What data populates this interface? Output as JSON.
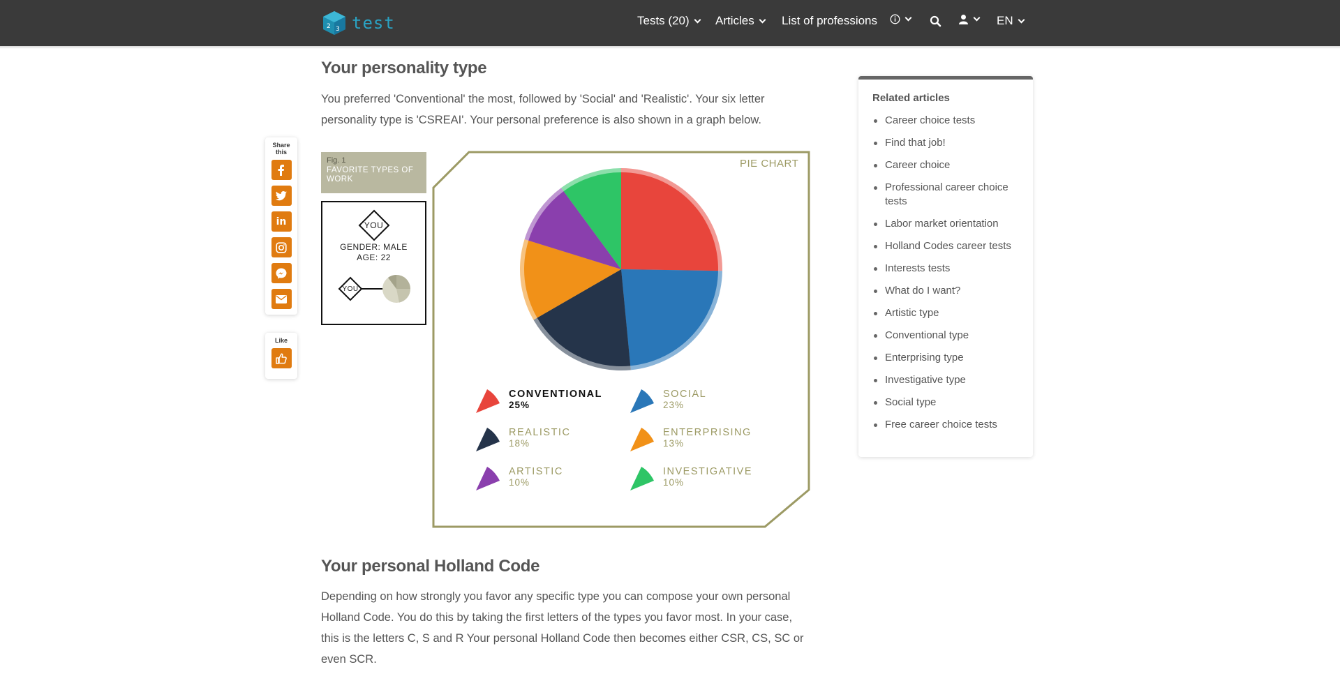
{
  "nav": {
    "logo_text": "test",
    "tests_label": "Tests (20)",
    "articles_label": "Articles",
    "professions_label": "List of professions",
    "lang_label": "EN"
  },
  "main": {
    "heading1": "Your personality type",
    "intro": "You preferred 'Conventional' the most, followed by 'Social' and 'Realistic'. Your six letter personality type is 'CSREAI'. Your personal preference is also shown in a graph below.",
    "heading2": "Your personal Holland Code",
    "holland_text": "Depending on how strongly you favor any specific type you can compose your own personal Holland Code. You do this by taking the first letters of the types you favor most. In your case, this is the letters C, S and R Your personal Holland Code then becomes either CSR, CS, SC or even SCR."
  },
  "share": {
    "title": "Share this",
    "like_title": "Like",
    "buttons": [
      "facebook-icon",
      "twitter-icon",
      "linkedin-icon",
      "instagram-icon",
      "messenger-icon",
      "email-icon"
    ]
  },
  "figure": {
    "fig_number": "Fig. 1",
    "fig_title": "FAVORITE TYPES OF WORK",
    "you_label": "YOU",
    "gender": "GENDER: MALE",
    "age": "AGE: 22"
  },
  "chart_data": {
    "type": "pie",
    "title": "PIE CHART",
    "series": [
      {
        "name": "CONVENTIONAL",
        "value": 25,
        "label": "25%",
        "color": "#e8453c"
      },
      {
        "name": "SOCIAL",
        "value": 23,
        "label": "23%",
        "color": "#2a77b8"
      },
      {
        "name": "REALISTIC",
        "value": 18,
        "label": "18%",
        "color": "#25344a"
      },
      {
        "name": "ENTERPRISING",
        "value": 13,
        "label": "13%",
        "color": "#f19118"
      },
      {
        "name": "ARTISTIC",
        "value": 10,
        "label": "10%",
        "color": "#8a3fad"
      },
      {
        "name": "INVESTIGATIVE",
        "value": 10,
        "label": "10%",
        "color": "#2ec566"
      }
    ],
    "highlighted": "CONVENTIONAL"
  },
  "related": {
    "title": "Related articles",
    "items": [
      "Career choice tests",
      "Find that job!",
      "Career choice",
      "Professional career choice tests",
      "Labor market orientation",
      "Holland Codes career tests",
      "Interests tests",
      "What do I want?",
      "Artistic type",
      "Conventional type",
      "Enterprising type",
      "Investigative type",
      "Social type",
      "Free career choice tests"
    ]
  },
  "colors": {
    "nav_bg": "#3a3a3a",
    "accent_orange": "#e07b10",
    "olive": "#9c9a64",
    "logo_blue": "#2aa3c4"
  }
}
